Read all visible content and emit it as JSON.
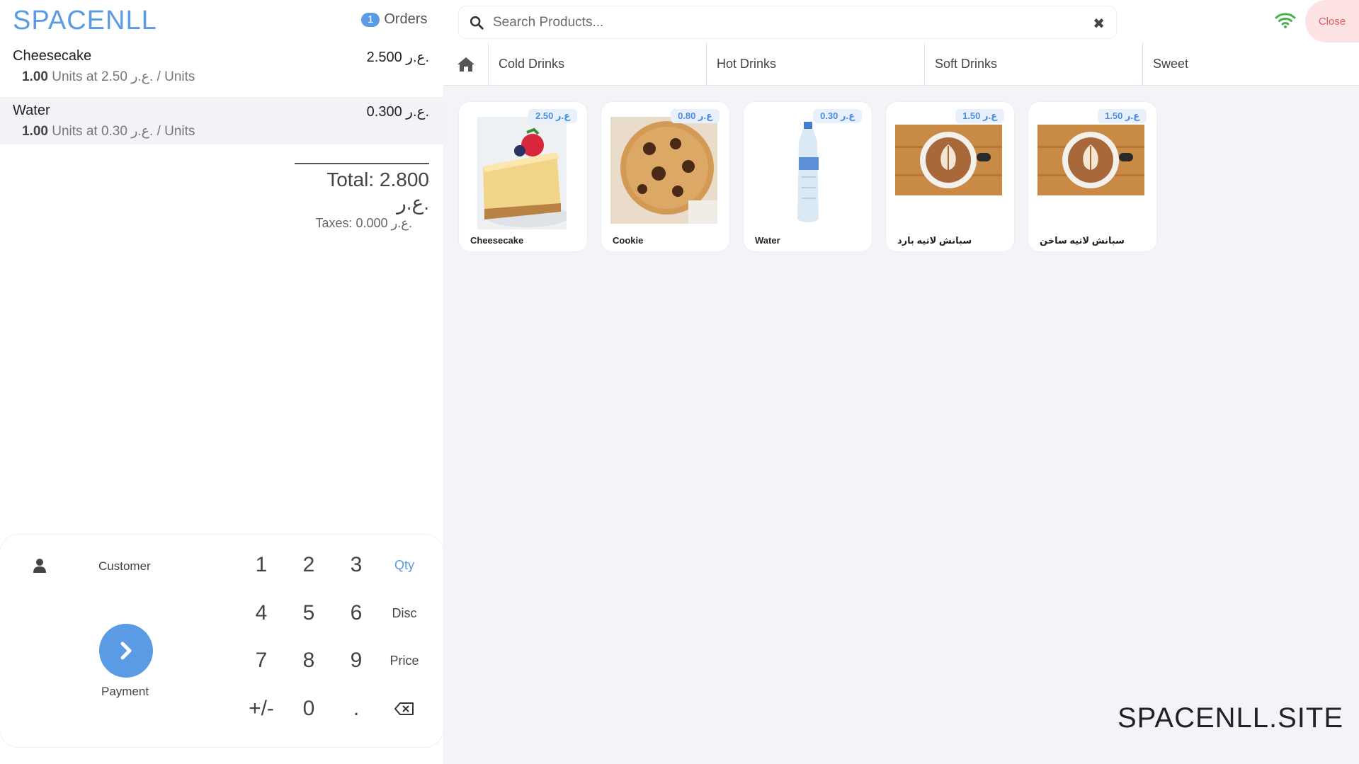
{
  "header": {
    "brand": "SPACENLL",
    "orders_count": "1",
    "orders_label": "Orders",
    "search_placeholder": "Search Products...",
    "close_label": "Close",
    "accent_color": "#5b9be6",
    "wifi_color": "#4caf50"
  },
  "order": {
    "lines": [
      {
        "name": "Cheesecake",
        "price": "2.500 ع.ر.",
        "qty": "1.00",
        "detail": "Units at 2.50 ع.ر. / Units"
      },
      {
        "name": "Water",
        "price": "0.300 ع.ر.",
        "qty": "1.00",
        "detail": "Units at 0.30 ع.ر. / Units"
      }
    ],
    "total": "Total: 2.800 ع.ر.",
    "taxes": "Taxes: 0.000 ع.ر."
  },
  "pad": {
    "customer_label": "Customer",
    "payment_label": "Payment",
    "keys": [
      "1",
      "2",
      "3",
      "Qty",
      "4",
      "5",
      "6",
      "Disc",
      "7",
      "8",
      "9",
      "Price",
      "+/-",
      "0",
      "."
    ]
  },
  "categories": [
    "Cold Drinks",
    "Hot Drinks",
    "Soft Drinks",
    "Sweet"
  ],
  "products": [
    {
      "name": "Cheesecake",
      "price": "2.50 ع.ر"
    },
    {
      "name": "Cookie",
      "price": "0.80 ع.ر"
    },
    {
      "name": "Water",
      "price": "0.30 ع.ر"
    },
    {
      "name": "سبانش لاتيه بارد",
      "price": "1.50 ع.ر"
    },
    {
      "name": "سبانش لاتيه ساخن",
      "price": "1.50 ع.ر"
    }
  ],
  "watermark": "SPACENLL.SITE"
}
